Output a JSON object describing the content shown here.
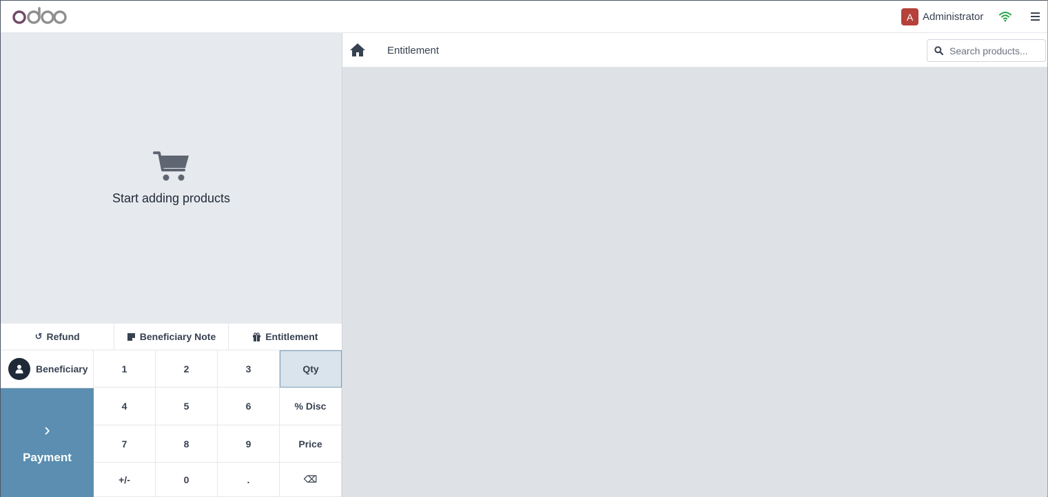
{
  "topbar": {
    "logo_text": "odoo",
    "user_initial": "A",
    "user_name": "Administrator",
    "avatar_color": "#b4413a"
  },
  "order": {
    "empty_message": "Start adding products"
  },
  "actions": [
    {
      "label": "Refund",
      "icon": "undo-icon"
    },
    {
      "label": "Beneficiary Note",
      "icon": "note-icon"
    },
    {
      "label": "Entitlement",
      "icon": "gift-icon"
    }
  ],
  "pad": {
    "beneficiary_label": "Beneficiary",
    "payment_label": "Payment",
    "payment_color": "#5b8eb0",
    "keys": [
      "1",
      "2",
      "3",
      "Qty",
      "4",
      "5",
      "6",
      "% Disc",
      "7",
      "8",
      "9",
      "Price",
      "+/-",
      "0",
      ".",
      "⌫"
    ],
    "active_mode": "Qty"
  },
  "products": {
    "breadcrumb": "Entitlement",
    "search_placeholder": "Search products..."
  }
}
